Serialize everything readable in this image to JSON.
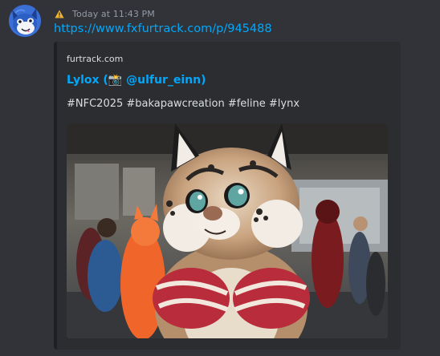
{
  "message": {
    "avatar_icon": "blue-fursuit-avatar",
    "status_icon": "warning-icon",
    "status_color": "#f0b232",
    "timestamp": "Today at 11:43 PM",
    "link_text": "https://www.fxfurtrack.com/p/945488"
  },
  "embed": {
    "provider": "furtrack.com",
    "title_prefix": "Lylox (",
    "title_emoji": "📸",
    "title_handle": " @ulfur_einn)",
    "description": "#NFC2025 #bakapawcreation #feline #lynx",
    "image_subject": "lynx-fursuit-photo",
    "accent_color": "#00a8fc"
  }
}
